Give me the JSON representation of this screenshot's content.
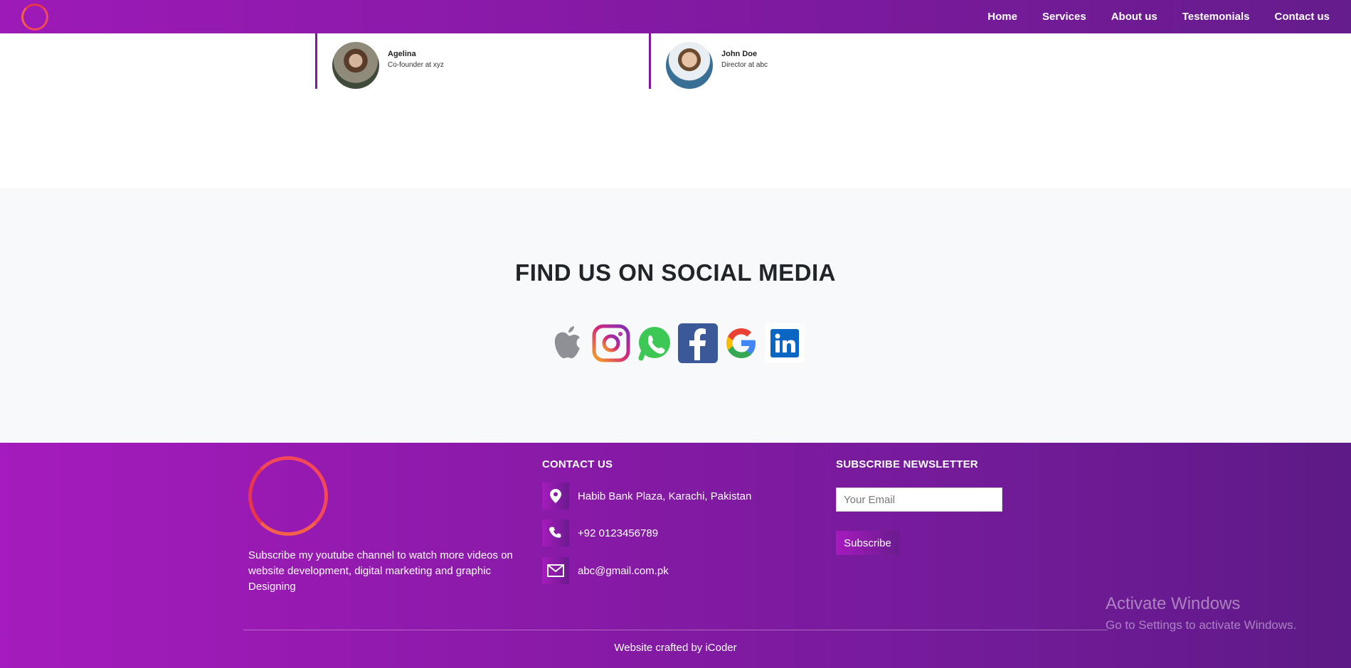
{
  "nav": {
    "links": [
      "Home",
      "Services",
      "About us",
      "Testemonials",
      "Contact us"
    ]
  },
  "testimonials": [
    {
      "name": "Agelina",
      "role": "Co-founder at xyz"
    },
    {
      "name": "John Doe",
      "role": "Director at abc"
    }
  ],
  "social": {
    "title": "FIND US ON SOCIAL MEDIA",
    "icons": [
      "apple-icon",
      "instagram-icon",
      "whatsapp-icon",
      "facebook-icon",
      "google-icon",
      "linkedin-icon"
    ]
  },
  "footer": {
    "about": "Subscribe my youtube channel to watch more videos on website development, digital marketing and graphic Designing",
    "contact_title": "CONTACT US",
    "address": "Habib Bank Plaza, Karachi, Pakistan",
    "phone": "+92 0123456789",
    "email": "abc@gmail.com.pk",
    "newsletter_title": "SUBSCRIBE NEWSLETTER",
    "email_placeholder": "Your Email",
    "subscribe_label": "Subscribe",
    "credits": "Website crafted by iCoder"
  },
  "watermark": {
    "title": "Activate Windows",
    "subtitle": "Go to Settings to activate Windows."
  },
  "colors": {
    "brand_purple": "#8a1aa8",
    "logo_ring": "#f2485a",
    "section_bg": "#f8f9fa"
  }
}
